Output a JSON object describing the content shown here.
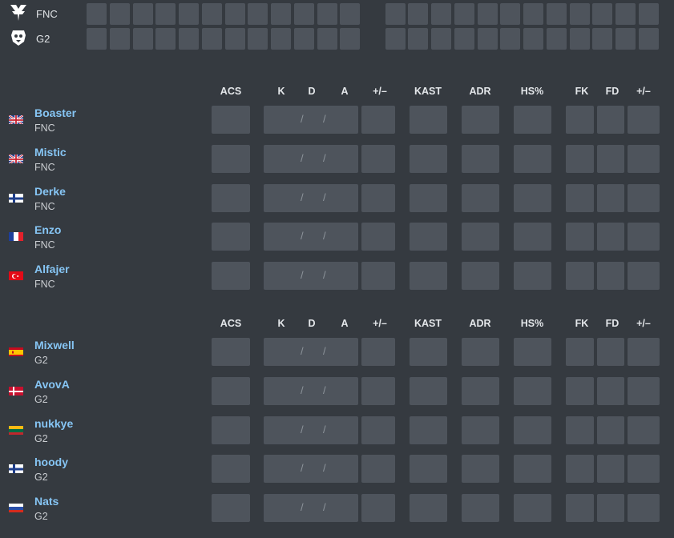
{
  "scoreboard": {
    "teams": [
      {
        "name": "FNC",
        "logo_icon": "fnatic-logo-icon"
      },
      {
        "name": "G2",
        "logo_icon": "g2-logo-icon"
      }
    ],
    "rounds_per_half": 12
  },
  "stat_headers": {
    "acs": "ACS",
    "k": "K",
    "d": "D",
    "a": "A",
    "pm": "+/–",
    "kast": "KAST",
    "adr": "ADR",
    "hs": "HS%",
    "fk": "FK",
    "fd": "FD",
    "pm2": "+/–"
  },
  "kda_separator": "/",
  "team_tables": [
    {
      "team": "FNC",
      "players": [
        {
          "name": "Boaster",
          "team": "FNC",
          "flag": "gb-flag-icon"
        },
        {
          "name": "Mistic",
          "team": "FNC",
          "flag": "gb-flag-icon"
        },
        {
          "name": "Derke",
          "team": "FNC",
          "flag": "fi-flag-icon"
        },
        {
          "name": "Enzo",
          "team": "FNC",
          "flag": "fr-flag-icon"
        },
        {
          "name": "Alfajer",
          "team": "FNC",
          "flag": "tr-flag-icon"
        }
      ]
    },
    {
      "team": "G2",
      "players": [
        {
          "name": "Mixwell",
          "team": "G2",
          "flag": "es-flag-icon"
        },
        {
          "name": "AvovA",
          "team": "G2",
          "flag": "dk-flag-icon"
        },
        {
          "name": "nukkye",
          "team": "G2",
          "flag": "lt-flag-icon"
        },
        {
          "name": "hoody",
          "team": "G2",
          "flag": "fi-flag-icon"
        },
        {
          "name": "Nats",
          "team": "G2",
          "flag": "ru-flag-icon"
        }
      ]
    }
  ],
  "colors": {
    "background": "#353a40",
    "cell": "#4e545c",
    "player_name": "#86c5f4"
  }
}
